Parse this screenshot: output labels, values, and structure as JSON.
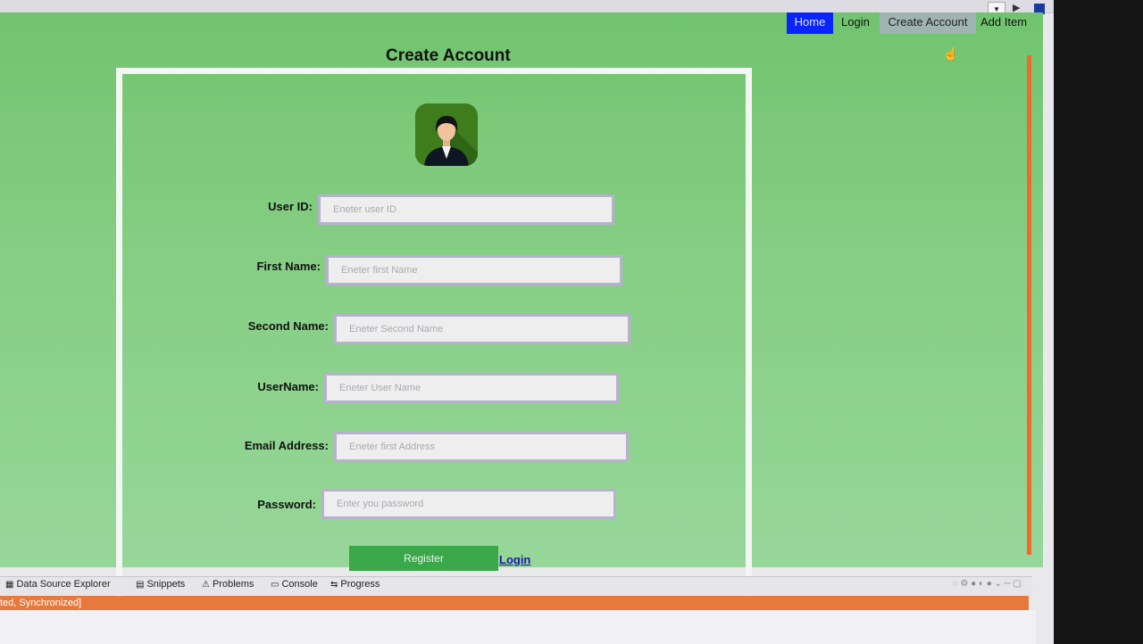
{
  "nav": {
    "home": "Home",
    "login": "Login",
    "create_account": "Create Account",
    "add_item": "Add Item"
  },
  "page_title": "Create Account",
  "form": {
    "fields": [
      {
        "label": "User ID:",
        "placeholder": "Eneter user ID"
      },
      {
        "label": "First Name:",
        "placeholder": "Eneter first Name"
      },
      {
        "label": "Second Name:",
        "placeholder": "Eneter Second Name"
      },
      {
        "label": "UserName:",
        "placeholder": "Eneter User Name"
      },
      {
        "label": "Email Address:",
        "placeholder": "Eneter first Address"
      },
      {
        "label": "Password:",
        "placeholder": "Enter you password"
      }
    ],
    "register_label": "Register",
    "login_link": "Login"
  },
  "ide": {
    "views": [
      "Data Source Explorer",
      "Snippets",
      "Problems",
      "Console",
      "Progress"
    ],
    "status": "ted, Synchronized]"
  },
  "colors": {
    "page_green": "#86ce84",
    "home_blue": "#0a24ff",
    "register_green": "#3aa74a",
    "status_orange": "#e6793b"
  }
}
